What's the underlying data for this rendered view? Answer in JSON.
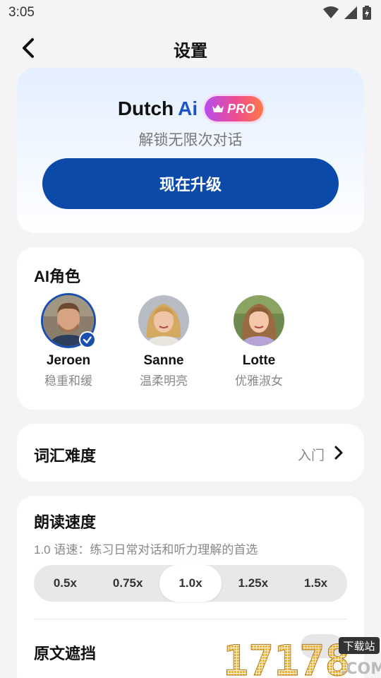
{
  "status": {
    "time": "3:05"
  },
  "header": {
    "title": "设置"
  },
  "pro": {
    "brand_dutch": "Dutch",
    "brand_ai": "Ai",
    "badge": "PRO",
    "subtitle": "解锁无限次对话",
    "upgrade_label": "现在升级"
  },
  "ai_roles": {
    "title": "AI角色",
    "roles": [
      {
        "name": "Jeroen",
        "desc": "稳重和缓",
        "selected": true
      },
      {
        "name": "Sanne",
        "desc": "温柔明亮",
        "selected": false
      },
      {
        "name": "Lotte",
        "desc": "优雅淑女",
        "selected": false
      }
    ]
  },
  "vocabulary": {
    "title": "词汇难度",
    "value": "入门"
  },
  "speed": {
    "title": "朗读速度",
    "desc": "1.0 语速：练习日常对话和听力理解的首选",
    "options": [
      "0.5x",
      "0.75x",
      "1.0x",
      "1.25x",
      "1.5x"
    ],
    "selected": "1.0x"
  },
  "text_mask": {
    "title": "原文遮挡"
  },
  "watermark": {
    "digits": "17178",
    "tag": "下载站",
    "domain": ".COM"
  },
  "colors": {
    "accent": "#0b4aa8",
    "brand_blue": "#1a56c4"
  }
}
